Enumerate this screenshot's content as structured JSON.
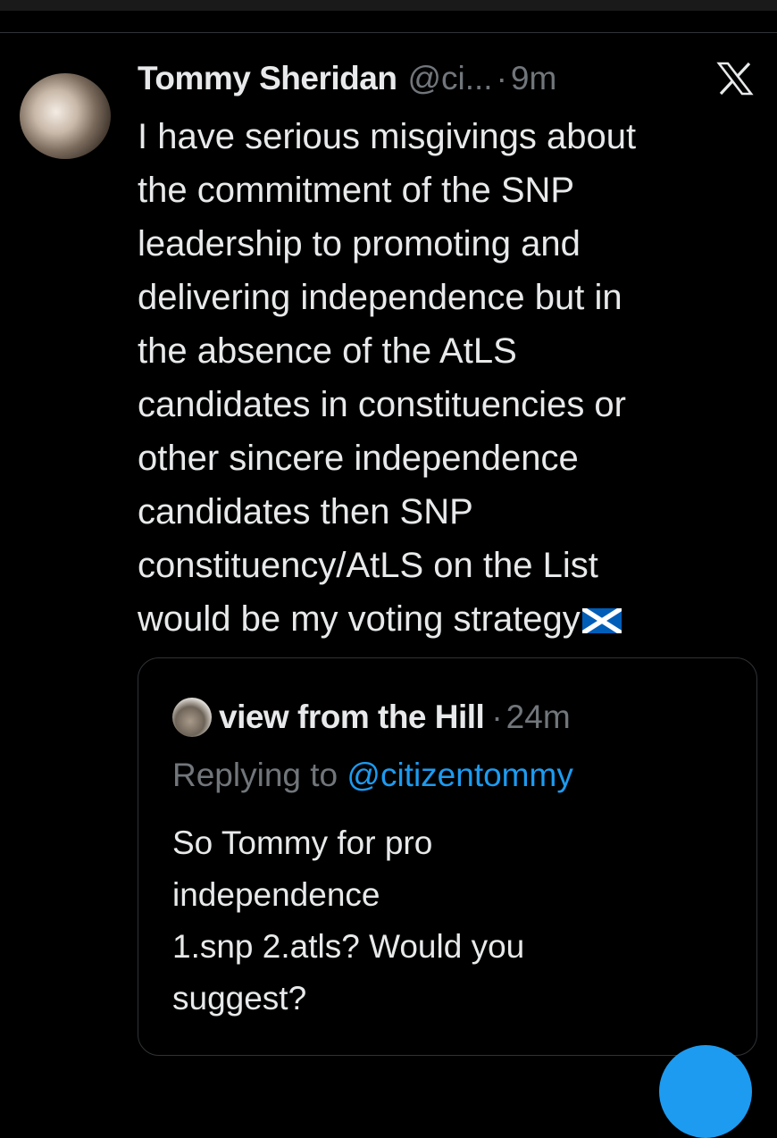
{
  "tweet": {
    "author_name": "Tommy Sheridan",
    "author_handle": "@ci...",
    "separator": "·",
    "time": "9m",
    "platform_icon": "x-logo-icon",
    "text": "I have serious misgivings about\nthe commitment of the SNP\nleadership to promoting and\ndelivering independence but in\nthe absence of the AtLS\ncandidates in constituencies or\nother sincere independence\ncandidates then SNP\nconstituency/AtLS on the List\nwould be my voting strategy",
    "emoji": "scotland-flag-icon"
  },
  "quoted_tweet": {
    "author_name": "view from the Hill",
    "separator": "·",
    "time": "24m",
    "replying_prefix": "Replying to ",
    "replying_handle": "@citizentommy",
    "text": "So Tommy for pro\nindependence\n1.snp 2.atls? Would you\nsuggest?"
  },
  "colors": {
    "background": "#000000",
    "text_primary": "#e7e9ea",
    "text_secondary": "#71767b",
    "accent": "#1d9bf0",
    "border": "#2f3336"
  }
}
